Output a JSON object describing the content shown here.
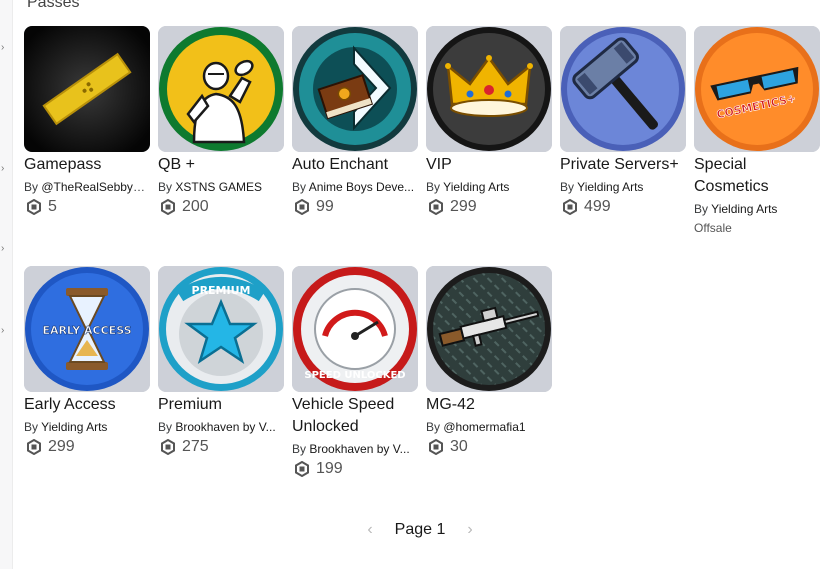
{
  "section": {
    "title": "Passes"
  },
  "items": [
    {
      "name": "Gamepass",
      "by": "By",
      "creator": "@TheRealSebbya...",
      "price": "5",
      "icon": "gold-ticket-icon"
    },
    {
      "name": "QB +",
      "by": "By",
      "creator": "XSTNS GAMES",
      "price": "200",
      "icon": "quarterback-icon"
    },
    {
      "name": "Auto Enchant",
      "by": "By",
      "creator": "Anime Boys Deve...",
      "price": "99",
      "icon": "enchant-book-icon"
    },
    {
      "name": "VIP",
      "by": "By",
      "creator": "Yielding Arts",
      "price": "299",
      "icon": "crown-icon"
    },
    {
      "name": "Private Servers+",
      "by": "By",
      "creator": "Yielding Arts",
      "price": "499",
      "icon": "hammer-icon"
    },
    {
      "name": "Special Cosmetics",
      "by": "By",
      "creator": "Yielding Arts",
      "status": "Offsale",
      "icon": "sunglasses-icon",
      "badge_text": "COSMETICS+"
    },
    {
      "name": "Early Access",
      "by": "By",
      "creator": "Yielding Arts",
      "price": "299",
      "icon": "hourglass-icon",
      "badge_text": "EARLY ACCESS"
    },
    {
      "name": "Premium",
      "by": "By",
      "creator": "Brookhaven by V...",
      "price": "275",
      "icon": "star-icon",
      "badge_text": "PREMIUM"
    },
    {
      "name": "Vehicle Speed Unlocked",
      "by": "By",
      "creator": "Brookhaven by V...",
      "price": "199",
      "icon": "speedometer-icon",
      "badge_text": "SPEED UNLOCKED"
    },
    {
      "name": "MG-42",
      "by": "By",
      "creator": "@homermafia1",
      "price": "30",
      "icon": "machine-gun-icon"
    }
  ],
  "pager": {
    "label": "Page 1",
    "prev": "‹",
    "next": "›"
  },
  "colors": {
    "robux": "#555555",
    "text": "#191919"
  }
}
